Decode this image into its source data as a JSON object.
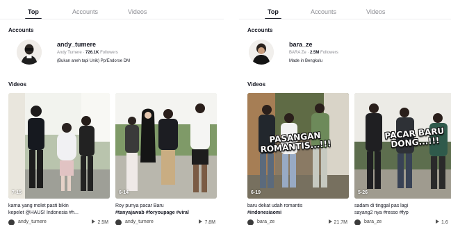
{
  "panels": [
    {
      "tabs": [
        {
          "label": "Top",
          "active": true
        },
        {
          "label": "Accounts",
          "active": false
        },
        {
          "label": "Videos",
          "active": false
        }
      ],
      "accounts_heading": "Accounts",
      "account": {
        "username": "andy_tumere",
        "display_name": "Andy Tumere",
        "followers_count": "726.1K",
        "followers_label": "Followers",
        "bio": "(Bukan aneh tapi Unik) Pp/Endorse DM"
      },
      "videos_heading": "Videos",
      "videos": [
        {
          "duration": "7-15",
          "caption_line1": "karna yang molet pasti bikin",
          "caption_line2": "kepelet @HAUS! Indonesia #h...",
          "user": "andy_tumere",
          "views": "2.5M"
        },
        {
          "duration": "6-14",
          "caption_line1": "Roy punya pacar Baru",
          "caption_line2": "#tanyajawab #foryoupage #viral",
          "user": "andy_tumere",
          "views": "7.8M"
        }
      ]
    },
    {
      "tabs": [
        {
          "label": "Top",
          "active": true
        },
        {
          "label": "Accounts",
          "active": false
        },
        {
          "label": "Videos",
          "active": false
        }
      ],
      "accounts_heading": "Accounts",
      "account": {
        "username": "bara_ze",
        "display_name": "BARA Ze",
        "followers_count": "2.5M",
        "followers_label": "Followers",
        "bio": "Made in Bengkulu"
      },
      "videos_heading": "Videos",
      "videos": [
        {
          "duration": "6-19",
          "overlay": [
            "PASANGAN",
            "ROMANTIS...!!!"
          ],
          "caption_line1": "baru dekat udah romantis",
          "caption_line2": "#indonesiaomi",
          "user": "bara_ze",
          "views": "21.7M"
        },
        {
          "duration": "5-26",
          "overlay": [
            "PACAR BARU",
            "DONG...!!!"
          ],
          "caption_line1": "sadam di tinggal pas lagi",
          "caption_line2": "sayang2 nya #resso #fyp",
          "user": "bara_ze",
          "views": "1.6"
        }
      ]
    }
  ],
  "icons": {
    "avatar": "user-avatar",
    "views": "play-icon"
  },
  "colors": {
    "active_tab": "#161823",
    "inactive_tab": "#8a8b91",
    "separator": "#eeeeef"
  }
}
